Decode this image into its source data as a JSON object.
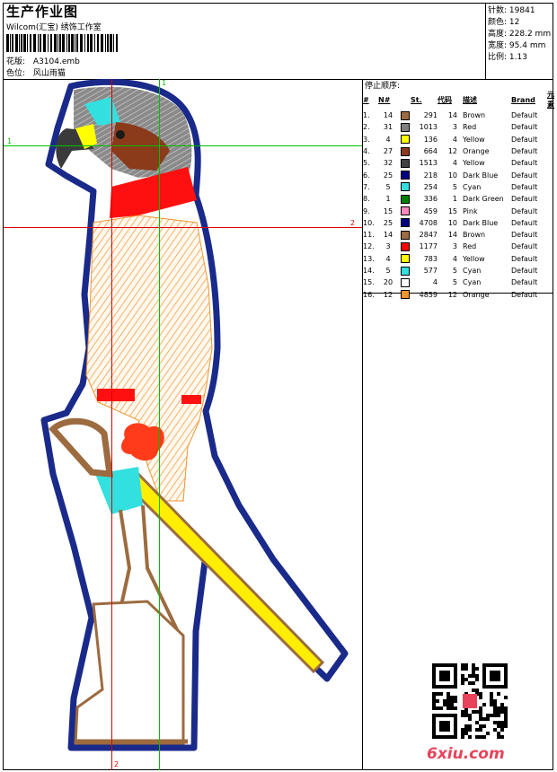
{
  "header": {
    "title": "生产作业图",
    "company": "Wilcom(汇宝) 绣饰工作室",
    "design_label": "花版:",
    "design_file": "A3104.emb",
    "colorway_label": "色位:",
    "colorway": "风山雨猫"
  },
  "stats": [
    {
      "label": "针数:",
      "value": "19841"
    },
    {
      "label": "颜色:",
      "value": "12"
    },
    {
      "label": "高度:",
      "value": "228.2 mm"
    },
    {
      "label": "宽度:",
      "value": "95.4 mm"
    },
    {
      "label": "比例:",
      "value": "1.13"
    }
  ],
  "color_table": {
    "heading": "停止顺序:",
    "columns": [
      "#",
      "N#",
      "St.",
      "代码",
      "描述",
      "Brand",
      "元素"
    ],
    "rows": [
      {
        "idx": "1.",
        "n": "14",
        "color": "#9c6b3f",
        "st": "291",
        "code": "14",
        "desc": "Brown",
        "brand": "Default"
      },
      {
        "idx": "2.",
        "n": "31",
        "color": "#808080",
        "st": "1013",
        "code": "3",
        "desc": "Red",
        "brand": "Default"
      },
      {
        "idx": "3.",
        "n": "4",
        "color": "#ffff00",
        "st": "136",
        "code": "4",
        "desc": "Yellow",
        "brand": "Default"
      },
      {
        "idx": "4.",
        "n": "27",
        "color": "#8b3a1a",
        "st": "664",
        "code": "12",
        "desc": "Orange",
        "brand": "Default"
      },
      {
        "idx": "5.",
        "n": "32",
        "color": "#404040",
        "st": "1513",
        "code": "4",
        "desc": "Yellow",
        "brand": "Default"
      },
      {
        "idx": "6.",
        "n": "25",
        "color": "#000080",
        "st": "218",
        "code": "10",
        "desc": "Dark Blue",
        "brand": "Default"
      },
      {
        "idx": "7.",
        "n": "5",
        "color": "#33e0e0",
        "st": "254",
        "code": "5",
        "desc": "Cyan",
        "brand": "Default"
      },
      {
        "idx": "8.",
        "n": "1",
        "color": "#008000",
        "st": "336",
        "code": "1",
        "desc": "Dark Green",
        "brand": "Default"
      },
      {
        "idx": "9.",
        "n": "15",
        "color": "#ff88bb",
        "st": "459",
        "code": "15",
        "desc": "Pink",
        "brand": "Default"
      },
      {
        "idx": "10.",
        "n": "25",
        "color": "#000080",
        "st": "4708",
        "code": "10",
        "desc": "Dark Blue",
        "brand": "Default"
      },
      {
        "idx": "11.",
        "n": "14",
        "color": "#9c6b3f",
        "st": "2847",
        "code": "14",
        "desc": "Brown",
        "brand": "Default"
      },
      {
        "idx": "12.",
        "n": "3",
        "color": "#ff0000",
        "st": "1177",
        "code": "3",
        "desc": "Red",
        "brand": "Default"
      },
      {
        "idx": "13.",
        "n": "4",
        "color": "#ffff00",
        "st": "783",
        "code": "4",
        "desc": "Yellow",
        "brand": "Default"
      },
      {
        "idx": "14.",
        "n": "5",
        "color": "#33e0e0",
        "st": "577",
        "code": "5",
        "desc": "Cyan",
        "brand": "Default"
      },
      {
        "idx": "15.",
        "n": "20",
        "color": "#ffffff",
        "st": "4",
        "code": "5",
        "desc": "Cyan",
        "brand": "Default"
      },
      {
        "idx": "16.",
        "n": "12",
        "color": "#f0952f",
        "st": "4859",
        "code": "12",
        "desc": "Orange",
        "brand": "Default"
      }
    ]
  },
  "guides": {
    "h1_label": "1",
    "h2_label": "2",
    "v1_label": "1",
    "v2_label": "2"
  },
  "design": {
    "outline_color": "#1a2a8a",
    "guide_green": "#00c000",
    "guide_red": "#e00000"
  },
  "watermark": "6xiu.com"
}
